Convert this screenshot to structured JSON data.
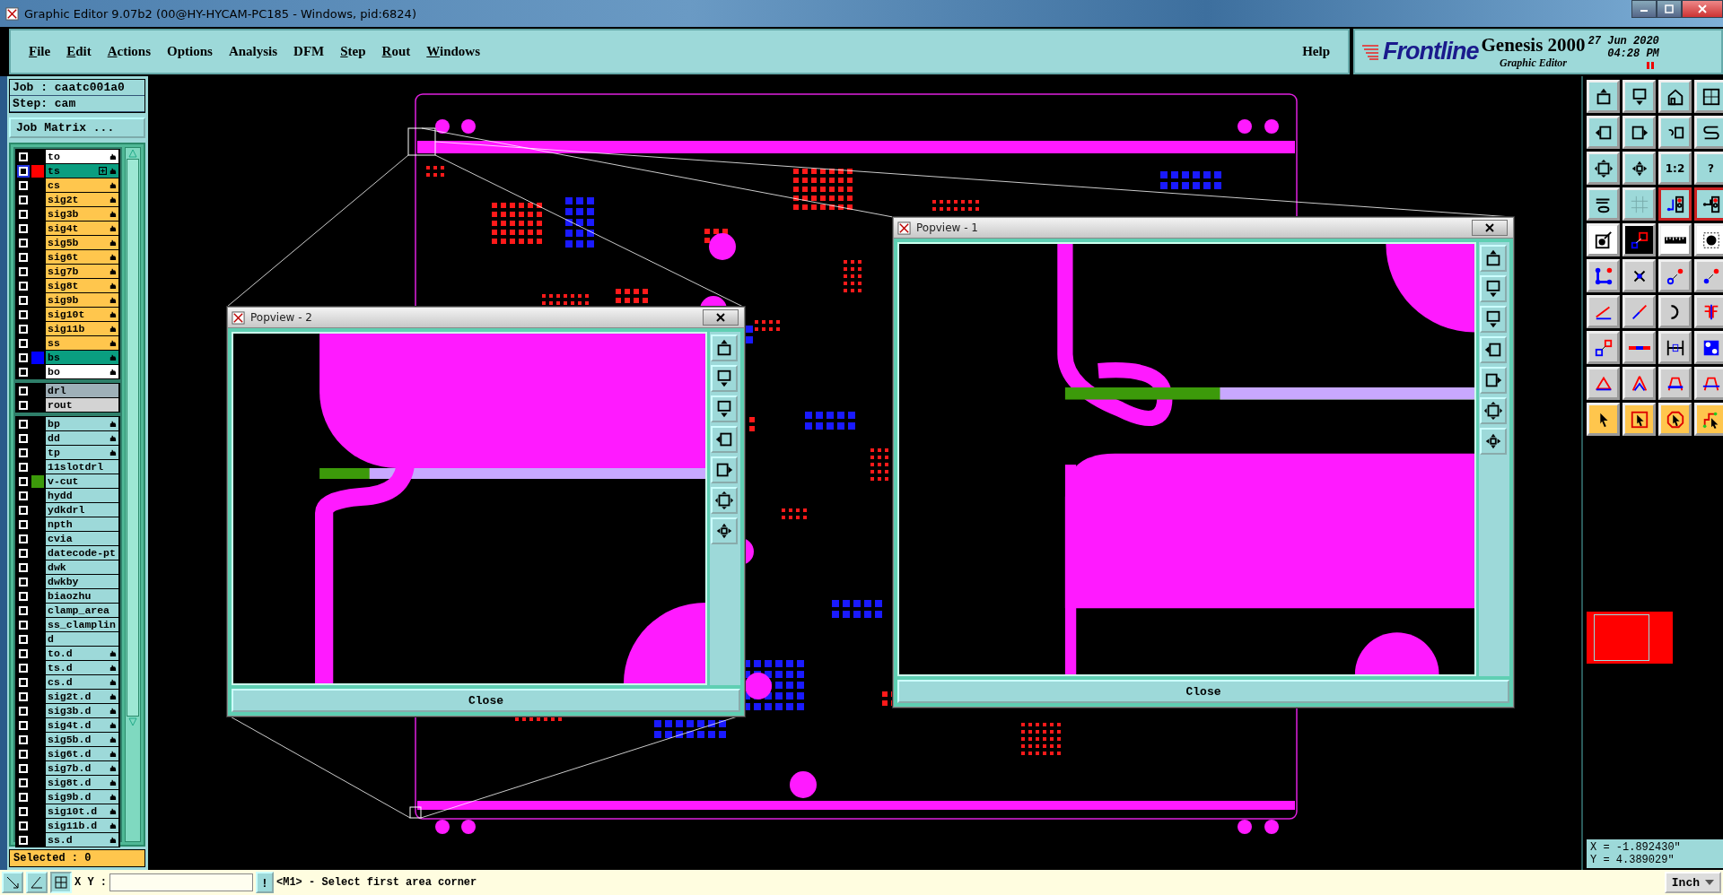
{
  "window": {
    "title": "Graphic Editor 9.07b2 (00@HY-HYCAM-PC185 - Windows, pid:6824)"
  },
  "menu": [
    {
      "label": "File",
      "mnemonic": true
    },
    {
      "label": "Edit",
      "mnemonic": true
    },
    {
      "label": "Actions",
      "mnemonic": true
    },
    {
      "label": "Options",
      "mnemonic": false
    },
    {
      "label": "Analysis",
      "mnemonic": false
    },
    {
      "label": "DFM",
      "mnemonic": false
    },
    {
      "label": "Step",
      "mnemonic": true
    },
    {
      "label": "Rout",
      "mnemonic": true
    },
    {
      "label": "Windows",
      "mnemonic": true
    }
  ],
  "help": "Help",
  "brand": {
    "logo": "Frontline",
    "product": "Genesis 2000",
    "subtitle": "Graphic Editor",
    "date": "27 Jun 2020",
    "time": "04:28 PM"
  },
  "job": {
    "job": "Job : caatc001a0",
    "step": "Step: cam",
    "matrix_button": "Job Matrix ...",
    "selected": "Selected : 0"
  },
  "layer_groups": [
    [
      {
        "name": "to",
        "kind": "silk",
        "hand": true,
        "checked": false,
        "focused": false
      },
      {
        "name": "ts",
        "kind": "mask",
        "hand": true,
        "checked": false,
        "focused": true,
        "color": "#ff0000"
      },
      {
        "name": "cs",
        "kind": "signal",
        "hand": true,
        "checked": false,
        "focused": false
      },
      {
        "name": "sig2t",
        "kind": "signal",
        "hand": true,
        "checked": false,
        "focused": false
      },
      {
        "name": "sig3b",
        "kind": "signal",
        "hand": true,
        "checked": false,
        "focused": false
      },
      {
        "name": "sig4t",
        "kind": "signal",
        "hand": true,
        "checked": false,
        "focused": false
      },
      {
        "name": "sig5b",
        "kind": "signal",
        "hand": true,
        "checked": false,
        "focused": false
      },
      {
        "name": "sig6t",
        "kind": "signal",
        "hand": true,
        "checked": false,
        "focused": false
      },
      {
        "name": "sig7b",
        "kind": "signal",
        "hand": true,
        "checked": false,
        "focused": false
      },
      {
        "name": "sig8t",
        "kind": "signal",
        "hand": true,
        "checked": false,
        "focused": false
      },
      {
        "name": "sig9b",
        "kind": "signal",
        "hand": true,
        "checked": false,
        "focused": false
      },
      {
        "name": "sig10t",
        "kind": "signal",
        "hand": true,
        "checked": false,
        "focused": false
      },
      {
        "name": "sig11b",
        "kind": "signal",
        "hand": true,
        "checked": false,
        "focused": false
      },
      {
        "name": "ss",
        "kind": "signal",
        "hand": true,
        "checked": false,
        "focused": false
      },
      {
        "name": "bs",
        "kind": "mask",
        "hand": true,
        "checked": false,
        "focused": false,
        "color": "#0000ff"
      },
      {
        "name": "bo",
        "kind": "silk",
        "hand": true,
        "checked": false,
        "focused": false
      }
    ],
    [
      {
        "name": "drl",
        "kind": "drill",
        "hand": false,
        "checked": false,
        "focused": false
      },
      {
        "name": "rout",
        "kind": "rout",
        "hand": false,
        "checked": false,
        "focused": false
      }
    ],
    [
      {
        "name": "bp",
        "kind": "misc",
        "hand": true,
        "checked": false,
        "focused": false
      },
      {
        "name": "dd",
        "kind": "misc",
        "hand": true,
        "checked": false,
        "focused": false
      },
      {
        "name": "tp",
        "kind": "misc",
        "hand": true,
        "checked": false,
        "focused": false
      },
      {
        "name": "11slotdrl",
        "kind": "misc",
        "hand": false,
        "checked": false,
        "focused": false
      },
      {
        "name": "v-cut",
        "kind": "misc",
        "hand": false,
        "checked": false,
        "focused": false,
        "color": "#3c9a0a"
      },
      {
        "name": "hydd",
        "kind": "misc",
        "hand": false,
        "checked": false,
        "focused": false
      },
      {
        "name": "ydkdrl",
        "kind": "misc",
        "hand": false,
        "checked": false,
        "focused": false
      },
      {
        "name": "npth",
        "kind": "misc",
        "hand": false,
        "checked": false,
        "focused": false
      },
      {
        "name": "cvia",
        "kind": "misc",
        "hand": false,
        "checked": false,
        "focused": false
      },
      {
        "name": "datecode-pt",
        "kind": "misc",
        "hand": false,
        "checked": false,
        "focused": false
      },
      {
        "name": "dwk",
        "kind": "misc",
        "hand": false,
        "checked": false,
        "focused": false
      },
      {
        "name": "dwkby",
        "kind": "misc",
        "hand": false,
        "checked": false,
        "focused": false
      },
      {
        "name": "biaozhu",
        "kind": "misc",
        "hand": false,
        "checked": false,
        "focused": false
      },
      {
        "name": "clamp_area",
        "kind": "misc",
        "hand": false,
        "checked": false,
        "focused": false
      },
      {
        "name": "ss_clamplin",
        "kind": "misc",
        "hand": false,
        "checked": false,
        "focused": false
      },
      {
        "name": "d",
        "kind": "misc",
        "hand": false,
        "checked": false,
        "focused": false
      },
      {
        "name": "to.d",
        "kind": "misc",
        "hand": true,
        "checked": false,
        "focused": false
      },
      {
        "name": "ts.d",
        "kind": "misc",
        "hand": true,
        "checked": false,
        "focused": false
      },
      {
        "name": "cs.d",
        "kind": "misc",
        "hand": true,
        "checked": false,
        "focused": false
      },
      {
        "name": "sig2t.d",
        "kind": "misc",
        "hand": true,
        "checked": false,
        "focused": false
      },
      {
        "name": "sig3b.d",
        "kind": "misc",
        "hand": true,
        "checked": false,
        "focused": false
      },
      {
        "name": "sig4t.d",
        "kind": "misc",
        "hand": true,
        "checked": false,
        "focused": false
      },
      {
        "name": "sig5b.d",
        "kind": "misc",
        "hand": true,
        "checked": false,
        "focused": false
      },
      {
        "name": "sig6t.d",
        "kind": "misc",
        "hand": true,
        "checked": false,
        "focused": false
      },
      {
        "name": "sig7b.d",
        "kind": "misc",
        "hand": true,
        "checked": false,
        "focused": false
      },
      {
        "name": "sig8t.d",
        "kind": "misc",
        "hand": true,
        "checked": false,
        "focused": false
      },
      {
        "name": "sig9b.d",
        "kind": "misc",
        "hand": true,
        "checked": false,
        "focused": false
      },
      {
        "name": "sig10t.d",
        "kind": "misc",
        "hand": true,
        "checked": false,
        "focused": false
      },
      {
        "name": "sig11b.d",
        "kind": "misc",
        "hand": true,
        "checked": false,
        "focused": false
      },
      {
        "name": "ss.d",
        "kind": "misc",
        "hand": true,
        "checked": false,
        "focused": false
      }
    ]
  ],
  "toolbar": [
    {
      "kind": "view",
      "on": false
    },
    {
      "kind": "view",
      "on": false
    },
    {
      "kind": "view",
      "on": false
    },
    {
      "kind": "view",
      "on": false
    },
    {
      "kind": "view",
      "on": false
    },
    {
      "kind": "view",
      "on": false
    },
    {
      "kind": "view",
      "on": false
    },
    {
      "kind": "view",
      "on": false
    },
    {
      "kind": "view",
      "on": false
    },
    {
      "kind": "view",
      "on": false
    },
    {
      "kind": "view",
      "on": false,
      "label": "1:2"
    },
    {
      "kind": "view",
      "on": false,
      "label": "?"
    },
    {
      "kind": "view",
      "on": false
    },
    {
      "kind": "view",
      "on": false
    },
    {
      "kind": "view",
      "on": true
    },
    {
      "kind": "view",
      "on": true
    },
    {
      "kind": "display",
      "on": false
    },
    {
      "kind": "display",
      "on": true
    },
    {
      "kind": "display",
      "on": false
    },
    {
      "kind": "display",
      "on": false
    },
    {
      "kind": "edit",
      "on": false
    },
    {
      "kind": "edit",
      "on": false
    },
    {
      "kind": "edit",
      "on": false
    },
    {
      "kind": "edit",
      "on": false
    },
    {
      "kind": "edit",
      "on": false
    },
    {
      "kind": "edit",
      "on": false
    },
    {
      "kind": "edit",
      "on": false
    },
    {
      "kind": "edit",
      "on": false
    },
    {
      "kind": "edit",
      "on": false
    },
    {
      "kind": "edit",
      "on": false
    },
    {
      "kind": "edit",
      "on": false
    },
    {
      "kind": "edit",
      "on": false
    },
    {
      "kind": "edit",
      "on": false
    },
    {
      "kind": "edit",
      "on": false
    },
    {
      "kind": "edit",
      "on": false
    },
    {
      "kind": "edit",
      "on": false
    },
    {
      "kind": "select",
      "on": false
    },
    {
      "kind": "select",
      "on": false
    },
    {
      "kind": "select",
      "on": false
    },
    {
      "kind": "select",
      "on": false
    }
  ],
  "coords": {
    "x": "X = -1.892430\"",
    "y": "Y = 4.389029\""
  },
  "popviews": [
    {
      "title": "Popview - 2",
      "close": "Close"
    },
    {
      "title": "Popview - 1",
      "close": "Close"
    }
  ],
  "status": {
    "xy_label": "X Y :",
    "bang": "!",
    "message": "<M1> - Select first area corner",
    "units": "Inch"
  }
}
